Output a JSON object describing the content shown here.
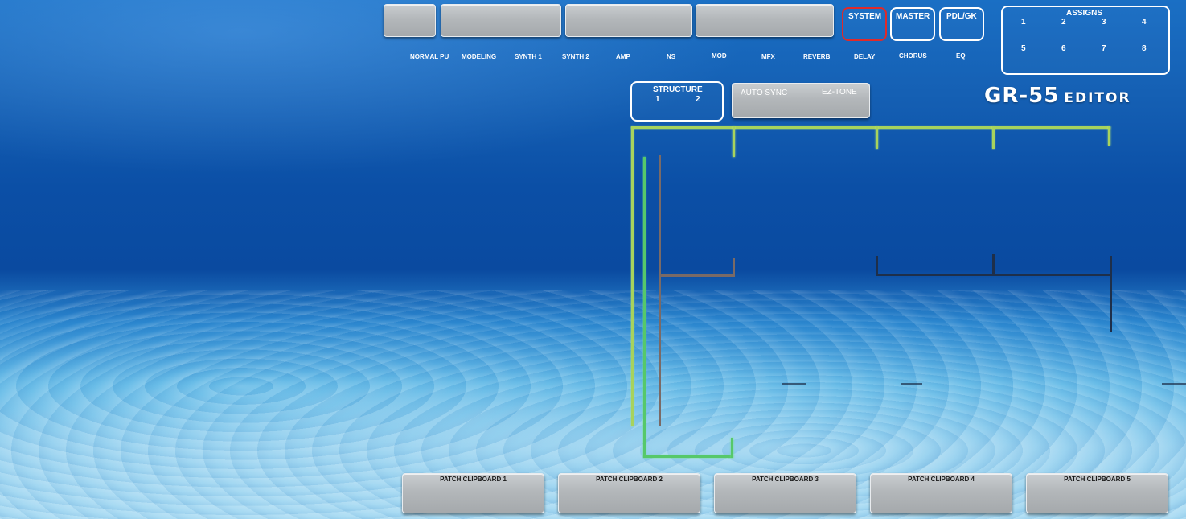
{
  "app": {
    "logo_main": "GR-55",
    "logo_sub": "EDITOR"
  },
  "top_nav": {
    "labels": [
      "NORMAL PU",
      "MODELING",
      "SYNTH 1",
      "SYNTH 2",
      "AMP",
      "NS",
      "MOD",
      "MFX",
      "REVERB",
      "DELAY",
      "CHORUS",
      "EQ"
    ],
    "system": "SYSTEM",
    "master": "MASTER",
    "pdl_gk": "PDL/GK"
  },
  "assigns": {
    "title": "ASSIGNS",
    "numbers": [
      "1",
      "2",
      "3",
      "4",
      "5",
      "6",
      "7",
      "8"
    ]
  },
  "structure": {
    "title": "STRUCTURE",
    "options": [
      "1",
      "2"
    ]
  },
  "auto_sync": "AUTO SYNC",
  "ez_tone": "EZ-TONE",
  "clipboards": [
    "PATCH CLIPBOARD 1",
    "PATCH CLIPBOARD 2",
    "PATCH CLIPBOARD 3",
    "PATCH CLIPBOARD 4",
    "PATCH CLIPBOARD 5"
  ],
  "colors": {
    "active_border": "#e02a2a",
    "line_green": "#a7d35d",
    "line_bright_green": "#56c86a",
    "line_brown": "#7a6a66",
    "line_dark": "#1e2f4a"
  }
}
